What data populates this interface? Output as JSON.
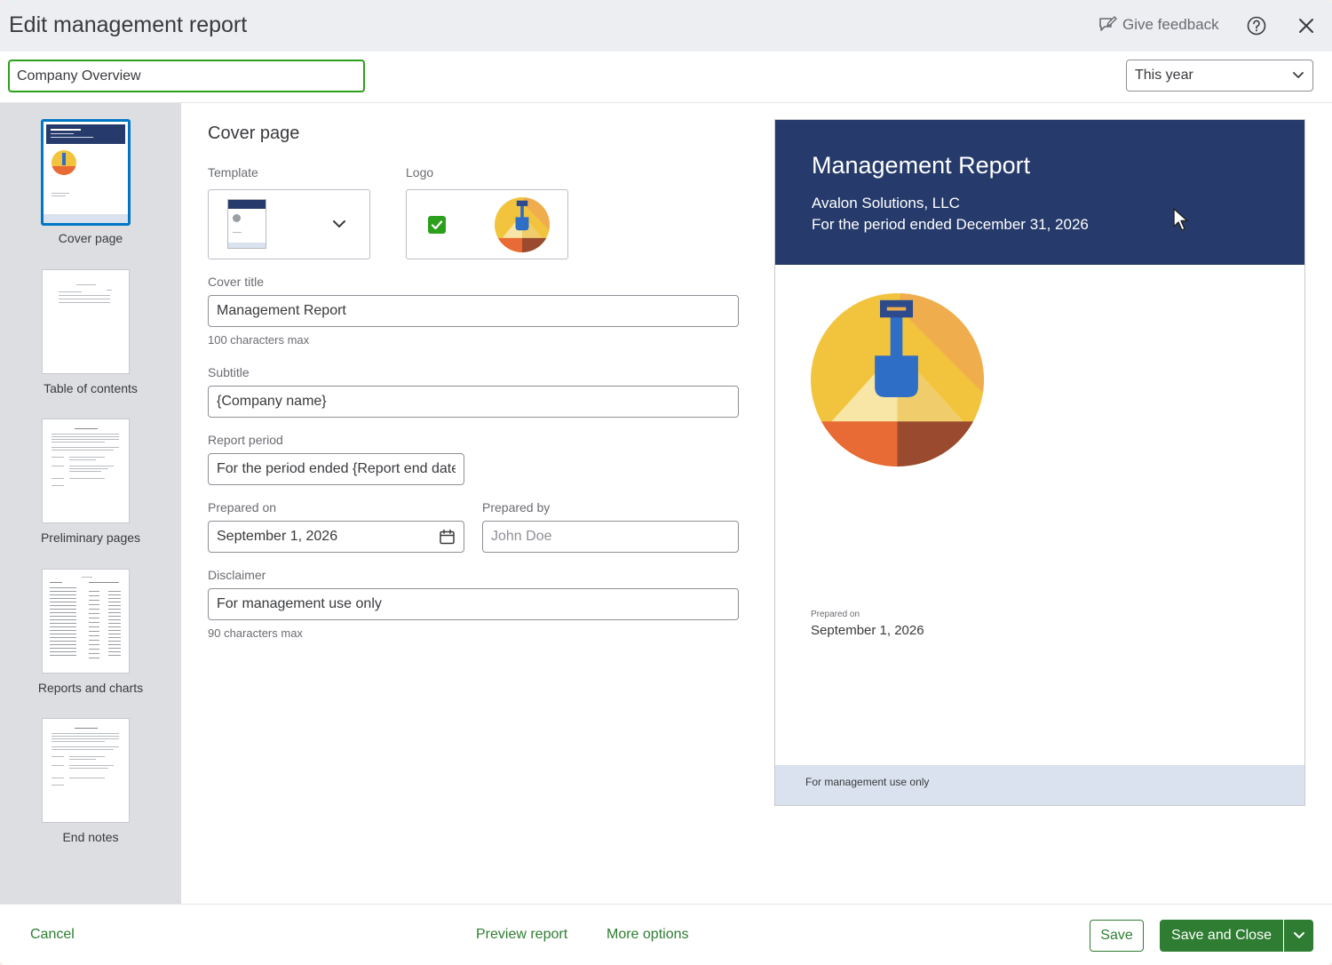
{
  "header": {
    "title": "Edit management report",
    "feedback_label": "Give feedback"
  },
  "topbar": {
    "report_name_value": "Company Overview",
    "period_selected": "This year"
  },
  "sidebar": {
    "items": [
      {
        "label": "Cover page",
        "active": true
      },
      {
        "label": "Table of contents",
        "active": false
      },
      {
        "label": "Preliminary pages",
        "active": false
      },
      {
        "label": "Reports and charts",
        "active": false
      },
      {
        "label": "End notes",
        "active": false
      }
    ]
  },
  "form": {
    "section_title": "Cover page",
    "template_label": "Template",
    "logo_label": "Logo",
    "cover_title_label": "Cover title",
    "cover_title_value": "Management Report",
    "cover_title_hint": "100 characters max",
    "subtitle_label": "Subtitle",
    "subtitle_value": "{Company name}",
    "report_period_label": "Report period",
    "report_period_value": "For the period ended {Report end date}",
    "prepared_on_label": "Prepared on",
    "prepared_on_value": "September 1, 2026",
    "prepared_by_label": "Prepared by",
    "prepared_by_placeholder": "John Doe",
    "disclaimer_label": "Disclaimer",
    "disclaimer_value": "For management use only",
    "disclaimer_hint": "90 characters max"
  },
  "preview": {
    "title": "Management Report",
    "company": "Avalon Solutions, LLC",
    "period": "For the period ended December 31, 2026",
    "prepared_on_label": "Prepared on",
    "prepared_on_date": "September 1, 2026",
    "disclaimer": "For management use only"
  },
  "footer": {
    "cancel": "Cancel",
    "preview_report": "Preview report",
    "more_options": "More options",
    "save": "Save",
    "save_and_close": "Save and Close"
  },
  "colors": {
    "brand_green": "#2e7d32",
    "preview_header": "#263b6b",
    "active_thumb": "#0077c5"
  }
}
